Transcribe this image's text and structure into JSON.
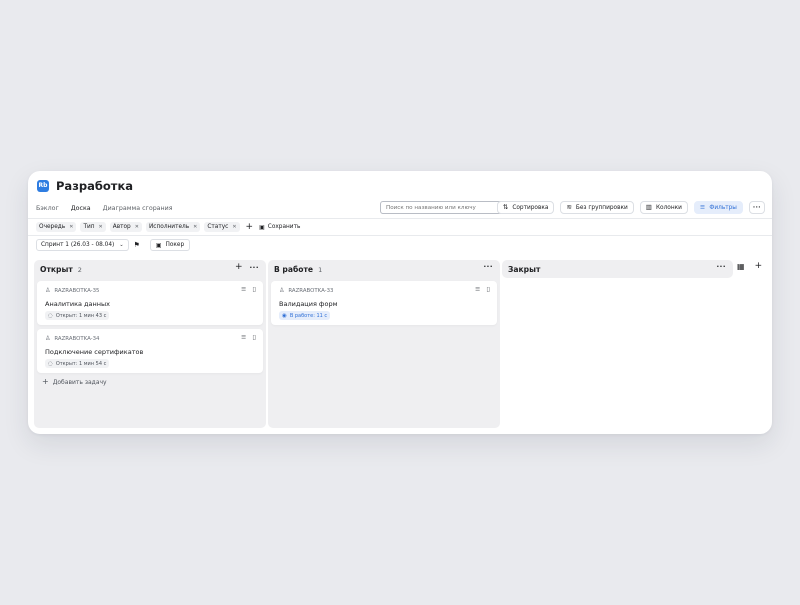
{
  "app": {
    "logo_text": "Rb",
    "title": "Разработка"
  },
  "tabs": [
    {
      "label": "Бэклог",
      "active": false
    },
    {
      "label": "Доска",
      "active": true
    },
    {
      "label": "Диаграмма сгорания",
      "active": false
    }
  ],
  "search": {
    "placeholder": "Поиск по названию или ключу",
    "value": ""
  },
  "toolbar": {
    "sort_label": "Сортировка",
    "group_label": "Без группировки",
    "columns_label": "Колонки",
    "filters_label": "Фильтры",
    "more_label": "···"
  },
  "filters": {
    "chips": [
      {
        "label": "Очередь"
      },
      {
        "label": "Тип"
      },
      {
        "label": "Автор"
      },
      {
        "label": "Исполнитель"
      },
      {
        "label": "Статус"
      }
    ],
    "remove_glyph": "✕",
    "add_glyph": "+",
    "save_label": "Сохранить"
  },
  "sprint": {
    "label": "Спринт 1 (26.03 - 08.04)",
    "poker_label": "Покер"
  },
  "columns": [
    {
      "title": "Открыт",
      "count": "2",
      "cards": [
        {
          "key": "RAZRABOTKA-35",
          "title": "Аналитика данных",
          "status": "Открыт: 1 мин 43 с",
          "status_type": "open"
        },
        {
          "key": "RAZRABOTKA-34",
          "title": "Подключение сертификатов",
          "status": "Открыт: 1 мин 54 с",
          "status_type": "open"
        }
      ],
      "add_task_label": "Добавить задачу"
    },
    {
      "title": "В работе",
      "count": "1",
      "cards": [
        {
          "key": "RAZRABOTKA-33",
          "title": "Валидация форм",
          "status": "В работе: 11 с",
          "status_type": "progress"
        }
      ]
    },
    {
      "title": "Закрыт",
      "count": "",
      "cards": []
    }
  ],
  "colors": {
    "accent": "#3c7be4",
    "active_button_bg": "#e5edfb",
    "column_bg": "#efeff1",
    "page_bg": "#e9eaee"
  },
  "icons": {
    "sort": "sort-icon",
    "group": "layers-icon",
    "columns": "columns-icon",
    "filters": "filter-icon",
    "flag": "flag-icon",
    "poker": "poker-icon",
    "calendar": "calendar-icon"
  }
}
